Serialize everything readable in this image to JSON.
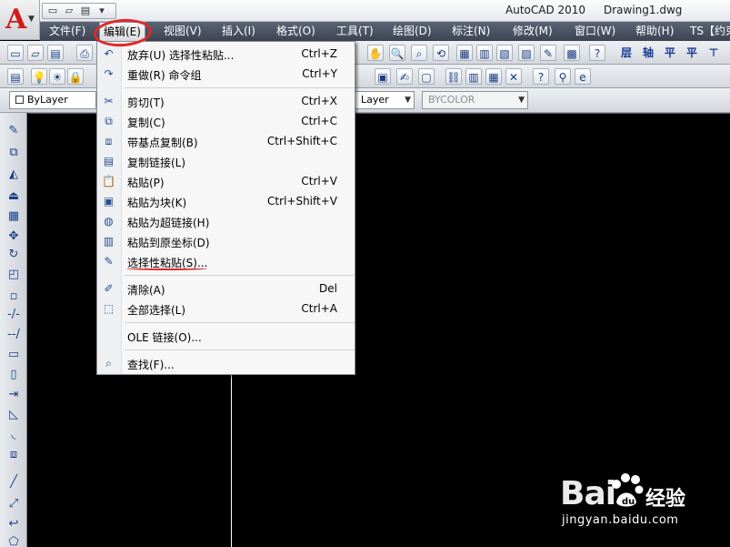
{
  "window": {
    "app_title": "AutoCAD 2010",
    "file_name": "Drawing1.dwg",
    "app_logo_letter": "A"
  },
  "menubar": {
    "items": [
      {
        "label": "文件(F)"
      },
      {
        "label": "编辑(E)"
      },
      {
        "label": "视图(V)"
      },
      {
        "label": "插入(I)"
      },
      {
        "label": "格式(O)"
      },
      {
        "label": "工具(T)"
      },
      {
        "label": "绘图(D)"
      },
      {
        "label": "标注(N)"
      },
      {
        "label": "修改(M)"
      },
      {
        "label": "窗口(W)"
      },
      {
        "label": "帮助(H)"
      },
      {
        "label": "TS【约束"
      }
    ],
    "active_index": 1
  },
  "properties": {
    "layer_combo": "ByLayer",
    "linetype_combo": "Layer",
    "plotstyle_combo": "BYCOLOR"
  },
  "edit_menu": {
    "items": [
      {
        "label": "放弃(U) 选择性粘贴...",
        "shortcut": "Ctrl+Z",
        "icon": "undo-icon"
      },
      {
        "label": "重做(R) 命令组",
        "shortcut": "Ctrl+Y",
        "icon": "redo-icon"
      },
      {
        "label": "剪切(T)",
        "shortcut": "Ctrl+X",
        "icon": "scissors-icon"
      },
      {
        "label": "复制(C)",
        "shortcut": "Ctrl+C",
        "icon": "copy-icon"
      },
      {
        "label": "带基点复制(B)",
        "shortcut": "Ctrl+Shift+C",
        "icon": "copy-base-point-icon"
      },
      {
        "label": "复制链接(L)",
        "shortcut": "",
        "icon": "copy-link-icon"
      },
      {
        "label": "粘贴(P)",
        "shortcut": "Ctrl+V",
        "icon": "paste-icon"
      },
      {
        "label": "粘贴为块(K)",
        "shortcut": "Ctrl+Shift+V",
        "icon": "paste-block-icon"
      },
      {
        "label": "粘贴为超链接(H)",
        "shortcut": "",
        "icon": "paste-hyperlink-icon"
      },
      {
        "label": "粘贴到原坐标(D)",
        "shortcut": "",
        "icon": "paste-original-coords-icon"
      },
      {
        "label": "选择性粘贴(S)...",
        "shortcut": "",
        "icon": "paste-special-icon"
      },
      {
        "label": "清除(A)",
        "shortcut": "Del",
        "icon": "eraser-icon"
      },
      {
        "label": "全部选择(L)",
        "shortcut": "Ctrl+A",
        "icon": "select-all-icon"
      },
      {
        "label": "OLE 链接(O)...",
        "shortcut": "",
        "icon": ""
      },
      {
        "label": "查找(F)...",
        "shortcut": "",
        "icon": "find-icon"
      }
    ]
  },
  "watermark": {
    "brand": "Bai",
    "brand_suffix": "经验",
    "url": "jingyan.baidu.com"
  }
}
